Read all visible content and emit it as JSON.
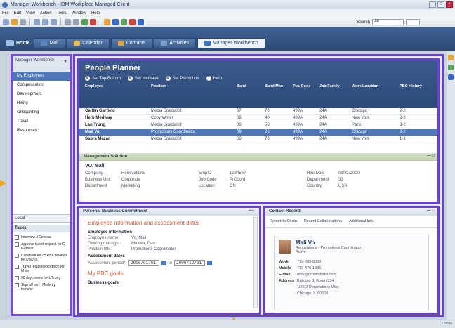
{
  "app": {
    "title": "Manager Workbench - IBM Workplace Managed Client",
    "menu": [
      "File",
      "Edit",
      "View",
      "Action",
      "Tools",
      "Window",
      "Help"
    ],
    "search": {
      "label": "Search",
      "value": "All"
    }
  },
  "tabs": {
    "home": "Home",
    "items": [
      {
        "label": "Mail",
        "color": "#5b86c4"
      },
      {
        "label": "Calendar",
        "color": "#e7b84a"
      },
      {
        "label": "Contacts",
        "color": "#d8a23f"
      },
      {
        "label": "Activities",
        "color": "#7a9fc9"
      },
      {
        "label": "Manager Workbench",
        "color": "#3b74c8"
      }
    ]
  },
  "sidebar": {
    "title": "Manager Workbench",
    "items": [
      "My Employees",
      "Compensation",
      "Development",
      "Hiring",
      "Onboarding",
      "Travel",
      "Resources"
    ],
    "local": "Local",
    "tasks_title": "Tasks",
    "tasks": [
      "Interview J Deveau",
      "Approve travel request for C Garfield",
      "Complete all 2H PBC reviews by 9/30/05",
      "Travel request exception for M Vo",
      "30 day review for L Trung",
      "Sign off on H Medway transfer"
    ]
  },
  "planner": {
    "title": "People Planner",
    "actions": [
      "Set Top/Bottom",
      "Set Increase",
      "Set Promotion",
      "Help"
    ],
    "columns": [
      "Employee",
      "Position",
      "Band",
      "Band Max",
      "Pos Code",
      "Job Family",
      "Work Location",
      "PBC History"
    ],
    "rows": [
      [
        "Caitlin Garfield",
        "Media Specialist",
        "07",
        "70",
        "499A",
        "24A",
        "Chicago",
        "2-2"
      ],
      [
        "Herb Medway",
        "Copy Writer",
        "08",
        "40",
        "499A",
        "24A",
        "New York",
        "2-2"
      ],
      [
        "Lan Trung",
        "Media Specialist",
        "08",
        "58",
        "499A",
        "24A",
        "Paris",
        "3-2"
      ],
      [
        "Mali Vo",
        "Promotions Coordinator",
        "09",
        "26",
        "499A",
        "24A",
        "Chicago",
        "2-2"
      ],
      [
        "Sabra Mazar",
        "Media Specialist",
        "08",
        "70",
        "499A",
        "24A",
        "New York",
        "1-1"
      ]
    ],
    "selected_row": 3
  },
  "management": {
    "bar": "Management Solution",
    "name": "VO, Mali",
    "fields": [
      [
        "Company",
        "Renovations",
        "EmpID",
        "1234567",
        "Hire Date",
        "01/31/2000"
      ],
      [
        "Business Unit",
        "Corporate",
        "Job Code",
        "PrCoord",
        "Department",
        "33"
      ],
      [
        "Department",
        "Marketing",
        "Location",
        "CN",
        "Country",
        "USA"
      ]
    ]
  },
  "pbc": {
    "bar": "Personal Business Commitment",
    "heading": "Employee information and assessment dates",
    "section1": "Employee information",
    "info": [
      [
        "Employee name:",
        "Vo, Mali"
      ],
      [
        "Owning manager:",
        "Moawa, Dan"
      ],
      [
        "Position title:",
        "Promotions Coordinator"
      ]
    ],
    "section2": "Assessment dates",
    "period_label": "Assessment period*:",
    "from": "2006/01/01",
    "to_label": "to",
    "to": "2006/12/31",
    "goals_title": "My PBC goals",
    "business_goals": "Business goals"
  },
  "contact": {
    "bar": "Contact Record",
    "tabs": [
      "Report-to Chain",
      "Recent Collaborations",
      "Additional Info"
    ],
    "name": "Mali Vo",
    "org": "Renovations - Promotions Coordinator",
    "status": "Active",
    "fields": [
      [
        "Work",
        "773-863-8888"
      ],
      [
        "Mobile",
        "773-476-1936"
      ],
      [
        "E-mail",
        "mvo@renovations.com"
      ],
      [
        "Address",
        "Building 8, Room 334"
      ],
      [
        "",
        "10002 Renovations Way"
      ],
      [
        "",
        "Chicago, IL 60603"
      ]
    ]
  },
  "status_bar": "Online"
}
